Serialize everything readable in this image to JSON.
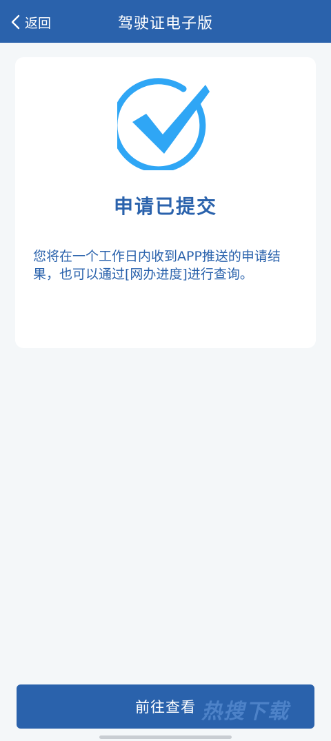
{
  "nav": {
    "back_label": "返回",
    "title": "驾驶证电子版"
  },
  "result": {
    "icon": "check-circle-icon",
    "title": "申请已提交",
    "message": "您将在一个工作日内收到APP推送的申请结果，也可以通过[网办进度]进行查询。"
  },
  "actions": {
    "primary_label": "前往查看"
  },
  "watermark": {
    "text": "热搜下载"
  },
  "colors": {
    "brand": "#2a62ac",
    "accent": "#2fa6f5",
    "background": "#f4f7f9"
  }
}
